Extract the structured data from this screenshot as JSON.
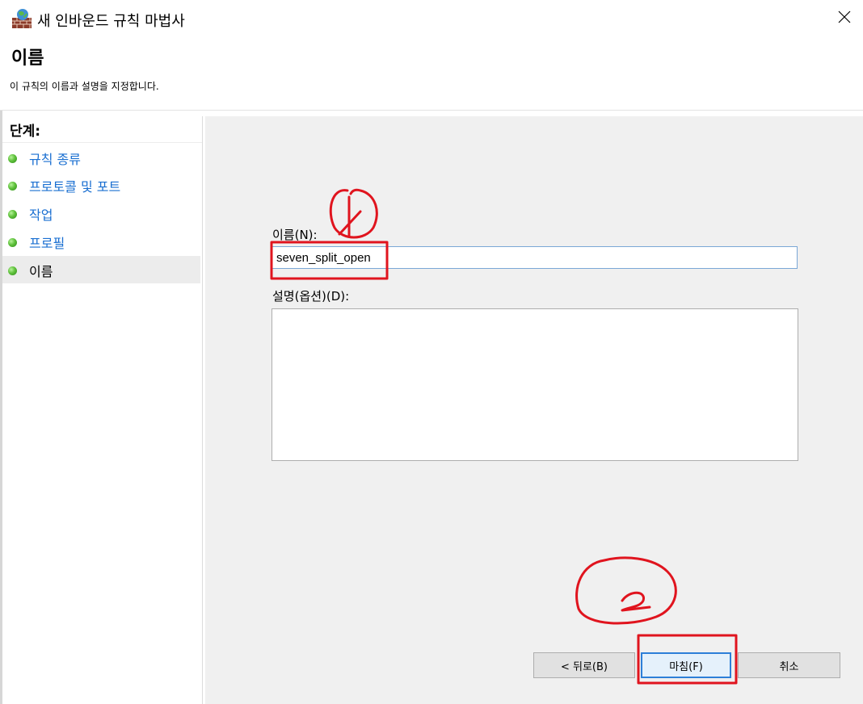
{
  "window": {
    "title": "새 인바운드 규칙 마법사",
    "icon": "firewall-icon",
    "close_icon": "close-icon"
  },
  "header": {
    "title": "이름",
    "description": "이 규칙의 이름과 설명을 지정합니다."
  },
  "steps": {
    "header": "단계:",
    "items": [
      {
        "label": "규칙 종류",
        "current": false
      },
      {
        "label": "프로토콜 및 포트",
        "current": false
      },
      {
        "label": "작업",
        "current": false
      },
      {
        "label": "프로필",
        "current": false
      },
      {
        "label": "이름",
        "current": true
      }
    ],
    "status_color": "#4caf2f",
    "link_color": "#1a6fd1"
  },
  "form": {
    "name_label": "이름(N):",
    "name_value": "seven_split_open",
    "description_label": "설명(옵션)(D):",
    "description_value": ""
  },
  "buttons": {
    "back": "< 뒤로(B)",
    "finish": "마침(F)",
    "cancel": "취소"
  },
  "annotations": {
    "color": "#e0141e",
    "marks": [
      "1",
      "2"
    ]
  }
}
